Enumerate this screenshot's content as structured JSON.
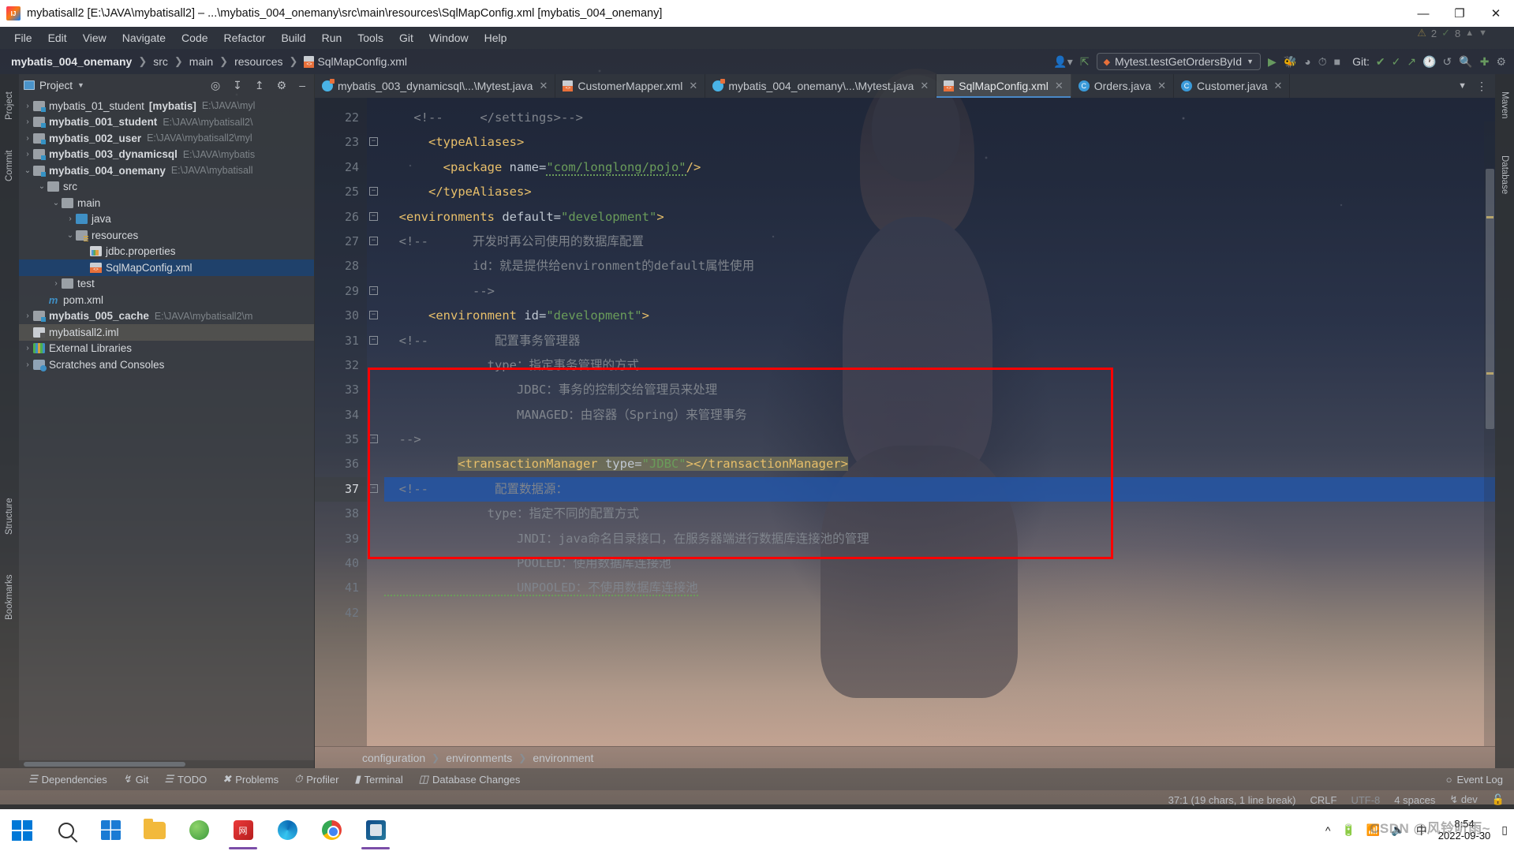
{
  "window": {
    "title": "mybatisall2 [E:\\JAVA\\mybatisall2] – ...\\mybatis_004_onemany\\src\\main\\resources\\SqlMapConfig.xml [mybatis_004_onemany]",
    "minimize": "—",
    "maximize": "❐",
    "close": "✕"
  },
  "menu": [
    "File",
    "Edit",
    "View",
    "Navigate",
    "Code",
    "Refactor",
    "Build",
    "Run",
    "Tools",
    "Git",
    "Window",
    "Help"
  ],
  "navbar": {
    "crumbs": [
      "mybatis_004_onemany",
      "src",
      "main",
      "resources",
      "SqlMapConfig.xml"
    ],
    "run_config": "Mytest.testGetOrdersById",
    "git_label": "Git:"
  },
  "project_panel": {
    "title": "Project",
    "tree": [
      {
        "indent": 0,
        "arrow": "›",
        "icon": "module",
        "label": "mybatis_01_student",
        "bracket": "[mybatis]",
        "path": "E:\\JAVA\\myl",
        "bold": false
      },
      {
        "indent": 0,
        "arrow": "›",
        "icon": "module",
        "label": "mybatis_001_student",
        "bracket": "",
        "path": "E:\\JAVA\\mybatisall2\\",
        "bold": true
      },
      {
        "indent": 0,
        "arrow": "›",
        "icon": "module",
        "label": "mybatis_002_user",
        "bracket": "",
        "path": "E:\\JAVA\\mybatisall2\\myl",
        "bold": true
      },
      {
        "indent": 0,
        "arrow": "›",
        "icon": "module",
        "label": "mybatis_003_dynamicsql",
        "bracket": "",
        "path": "E:\\JAVA\\mybatis",
        "bold": true
      },
      {
        "indent": 0,
        "arrow": "⌄",
        "icon": "module",
        "label": "mybatis_004_onemany",
        "bracket": "",
        "path": "E:\\JAVA\\mybatisall",
        "bold": true
      },
      {
        "indent": 1,
        "arrow": "⌄",
        "icon": "folder",
        "label": "src",
        "bracket": "",
        "path": "",
        "bold": false
      },
      {
        "indent": 2,
        "arrow": "⌄",
        "icon": "folder",
        "label": "main",
        "bracket": "",
        "path": "",
        "bold": false
      },
      {
        "indent": 3,
        "arrow": "›",
        "icon": "folderblue",
        "label": "java",
        "bracket": "",
        "path": "",
        "bold": false
      },
      {
        "indent": 3,
        "arrow": "⌄",
        "icon": "folderres",
        "label": "resources",
        "bracket": "",
        "path": "",
        "bold": false
      },
      {
        "indent": 4,
        "arrow": "",
        "icon": "props",
        "label": "jdbc.properties",
        "bracket": "",
        "path": "",
        "bold": false
      },
      {
        "indent": 4,
        "arrow": "",
        "icon": "xml",
        "label": "SqlMapConfig.xml",
        "bracket": "",
        "path": "",
        "bold": false,
        "selected": true
      },
      {
        "indent": 2,
        "arrow": "›",
        "icon": "folder",
        "label": "test",
        "bracket": "",
        "path": "",
        "bold": false
      },
      {
        "indent": 1,
        "arrow": "",
        "icon": "m",
        "label": "pom.xml",
        "bracket": "",
        "path": "",
        "bold": false
      },
      {
        "indent": 0,
        "arrow": "›",
        "icon": "module",
        "label": "mybatis_005_cache",
        "bracket": "",
        "path": "E:\\JAVA\\mybatisall2\\m",
        "bold": true
      },
      {
        "indent": 0,
        "arrow": "",
        "icon": "iml",
        "label": "mybatisall2.iml",
        "bracket": "",
        "path": "",
        "bold": false,
        "hover": true
      },
      {
        "indent": 0,
        "arrow": "›",
        "icon": "libs",
        "label": "External Libraries",
        "bracket": "",
        "path": "",
        "bold": false
      },
      {
        "indent": 0,
        "arrow": "›",
        "icon": "scratch",
        "label": "Scratches and Consoles",
        "bracket": "",
        "path": "",
        "bold": false
      }
    ]
  },
  "left_strip": [
    "Project",
    "Commit",
    "Structure",
    "Bookmarks"
  ],
  "right_strip": [
    "Maven",
    "Database"
  ],
  "editor": {
    "tabs": [
      {
        "label": "mybatis_003_dynamicsql\\...\\Mytest.java",
        "icon": "java",
        "active": false
      },
      {
        "label": "CustomerMapper.xml",
        "icon": "xml",
        "active": false
      },
      {
        "label": "mybatis_004_onemany\\...\\Mytest.java",
        "icon": "java",
        "active": false
      },
      {
        "label": "SqlMapConfig.xml",
        "icon": "xml",
        "active": true
      },
      {
        "label": "Orders.java",
        "icon": "class",
        "active": false
      },
      {
        "label": "Customer.java",
        "icon": "class",
        "active": false
      }
    ],
    "warnings": {
      "warn_count": "2",
      "ok_count": "8"
    },
    "first_line_number": 22,
    "lines": [
      {
        "n": 22,
        "fold": "",
        "segments": [
          {
            "t": "    ",
            "c": "punc"
          },
          {
            "t": "<!--     </settings>-->",
            "c": "cmt"
          }
        ]
      },
      {
        "n": 23,
        "fold": "-",
        "segments": [
          {
            "t": "      ",
            "c": "punc"
          },
          {
            "t": "<typeAliases>",
            "c": "tag"
          }
        ]
      },
      {
        "n": 24,
        "fold": "",
        "segments": [
          {
            "t": "        ",
            "c": "punc"
          },
          {
            "t": "<package ",
            "c": "tag"
          },
          {
            "t": "name=",
            "c": "attr"
          },
          {
            "t": "\"com/longlong/pojo\"",
            "c": "val squig"
          },
          {
            "t": "/>",
            "c": "tag"
          }
        ]
      },
      {
        "n": 25,
        "fold": "-",
        "segments": [
          {
            "t": "      ",
            "c": "punc"
          },
          {
            "t": "</typeAliases>",
            "c": "tag"
          }
        ]
      },
      {
        "n": 26,
        "fold": "-",
        "segments": [
          {
            "t": "  ",
            "c": "punc"
          },
          {
            "t": "<environments ",
            "c": "tag"
          },
          {
            "t": "default=",
            "c": "attr"
          },
          {
            "t": "\"development\"",
            "c": "val"
          },
          {
            "t": ">",
            "c": "tag"
          }
        ]
      },
      {
        "n": 27,
        "fold": "-",
        "segments": [
          {
            "t": "  ",
            "c": "punc"
          },
          {
            "t": "<!--      开发时再公司使用的数据库配置",
            "c": "cmt"
          }
        ]
      },
      {
        "n": 28,
        "fold": "",
        "segments": [
          {
            "t": "            id：就是提供给environment的default属性使用",
            "c": "cmt"
          }
        ]
      },
      {
        "n": 29,
        "fold": "-",
        "segments": [
          {
            "t": "            -->",
            "c": "cmt"
          }
        ]
      },
      {
        "n": 30,
        "fold": "-",
        "segments": [
          {
            "t": "      ",
            "c": "punc"
          },
          {
            "t": "<environment ",
            "c": "tag"
          },
          {
            "t": "id=",
            "c": "attr"
          },
          {
            "t": "\"development\"",
            "c": "val"
          },
          {
            "t": ">",
            "c": "tag"
          }
        ]
      },
      {
        "n": 31,
        "fold": "-",
        "segments": [
          {
            "t": "  ",
            "c": "punc"
          },
          {
            "t": "<!--         配置事务管理器",
            "c": "cmt"
          }
        ]
      },
      {
        "n": 32,
        "fold": "",
        "segments": [
          {
            "t": "              type：指定事务管理的方式",
            "c": "cmt"
          }
        ]
      },
      {
        "n": 33,
        "fold": "",
        "segments": [
          {
            "t": "                  JDBC：事务的控制交给管理员来处理",
            "c": "cmt"
          }
        ]
      },
      {
        "n": 34,
        "fold": "",
        "segments": [
          {
            "t": "                  MANAGED：由容器（Spring）来管理事务",
            "c": "cmt"
          }
        ]
      },
      {
        "n": 35,
        "fold": "-",
        "segments": [
          {
            "t": "  ",
            "c": "punc"
          },
          {
            "t": "-->",
            "c": "cmt"
          }
        ]
      },
      {
        "n": 36,
        "fold": "",
        "segments": [
          {
            "t": "          ",
            "c": "punc"
          },
          {
            "t": "<transactionManager ",
            "c": "tag hl"
          },
          {
            "t": "type=",
            "c": "attr hl"
          },
          {
            "t": "\"JDBC\"",
            "c": "val hl"
          },
          {
            "t": "></transactionManager>",
            "c": "tag hl"
          }
        ]
      },
      {
        "n": 37,
        "fold": "-",
        "segments": [
          {
            "t": "  ",
            "c": "punc"
          },
          {
            "t": "<!--         配置数据源：",
            "c": "cmt"
          }
        ],
        "selected": true
      },
      {
        "n": 38,
        "fold": "",
        "segments": [
          {
            "t": "              type：指定不同的配置方式",
            "c": "cmt"
          }
        ]
      },
      {
        "n": 39,
        "fold": "",
        "segments": [
          {
            "t": "                  JNDI：java命名目录接口，在服务器端进行数据库连接池的管理",
            "c": "cmt"
          }
        ]
      },
      {
        "n": 40,
        "fold": "",
        "segments": [
          {
            "t": "                  POOLED：使用数据库连接池",
            "c": "cmt"
          }
        ]
      },
      {
        "n": 41,
        "fold": "",
        "segments": [
          {
            "t": "                  UNPOOLED：不使用数据库连接池",
            "c": "cmt squig"
          }
        ]
      },
      {
        "n": 42,
        "fold": "",
        "segments": [
          {
            "t": "",
            "c": "punc"
          }
        ]
      }
    ],
    "breadcrumb": [
      "configuration",
      "environments",
      "environment"
    ]
  },
  "bottom_bar": {
    "items": [
      "Dependencies",
      "Git",
      "TODO",
      "Problems",
      "Profiler",
      "Terminal",
      "Database Changes"
    ],
    "event_log": "Event Log"
  },
  "status_bar": {
    "caret": "37:1 (19 chars, 1 line break)",
    "line_sep": "CRLF",
    "encoding": "UTF-8",
    "indent": "4 spaces",
    "branch": "dev",
    "lock": "🔓"
  },
  "taskbar": {
    "tray_lang": "中",
    "time": "8:54",
    "date": "2022-09-30",
    "watermark": "CSDN @风铃听雨~"
  }
}
